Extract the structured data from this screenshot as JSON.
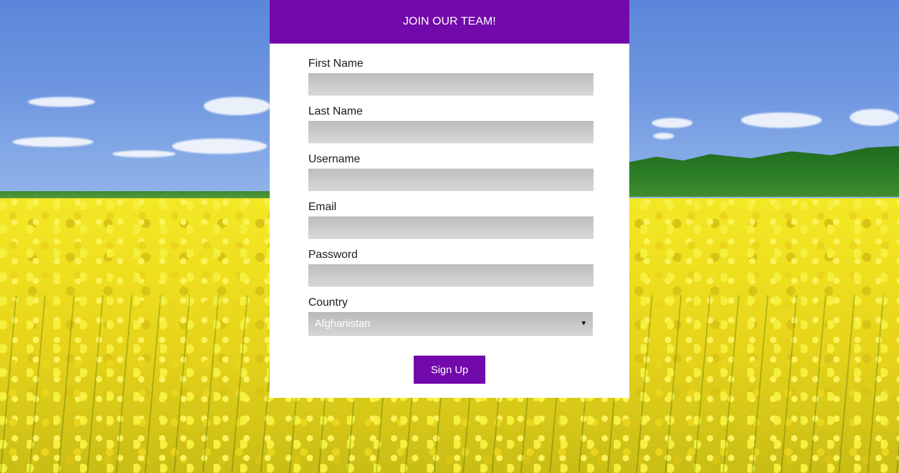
{
  "header": {
    "title": "JOIN OUR TEAM!"
  },
  "form": {
    "fields": [
      {
        "label": "First Name",
        "value": ""
      },
      {
        "label": "Last Name",
        "value": ""
      },
      {
        "label": "Username",
        "value": ""
      },
      {
        "label": "Email",
        "value": ""
      },
      {
        "label": "Password",
        "value": ""
      }
    ],
    "country": {
      "label": "Country",
      "selected": "Afghanistan"
    },
    "submit_label": "Sign Up"
  },
  "colors": {
    "accent": "#7209aa",
    "input_bg": "#c8c8c8"
  },
  "icons": {
    "select_caret": "caret-down-icon"
  }
}
